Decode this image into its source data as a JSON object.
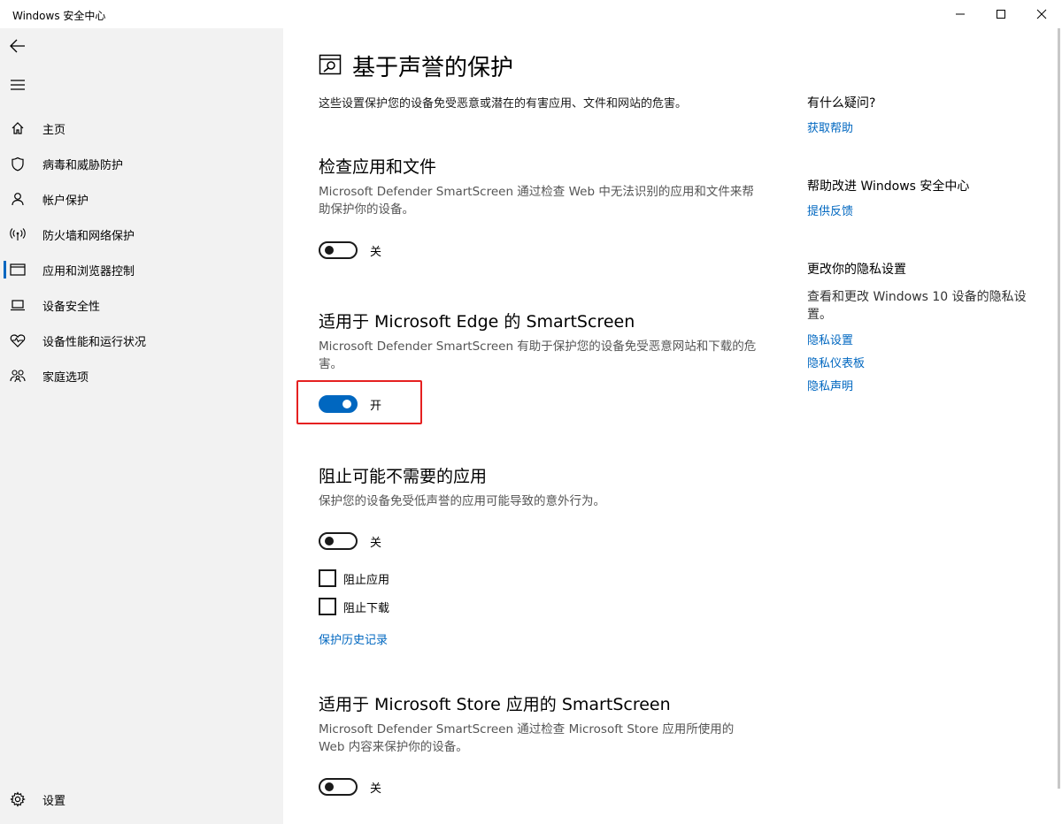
{
  "window": {
    "title": "Windows 安全中心",
    "controls": [
      "minimize-icon",
      "maximize-icon",
      "close-icon"
    ]
  },
  "sidebar": {
    "back_icon": "back-arrow-icon",
    "menu_icon": "hamburger-icon",
    "items": [
      {
        "label": "主页",
        "icon": "home-icon"
      },
      {
        "label": "病毒和威胁防护",
        "icon": "shield-icon"
      },
      {
        "label": "帐户保护",
        "icon": "person-icon"
      },
      {
        "label": "防火墙和网络保护",
        "icon": "antenna-icon"
      },
      {
        "label": "应用和浏览器控制",
        "icon": "app-window-icon",
        "selected": true
      },
      {
        "label": "设备安全性",
        "icon": "laptop-icon"
      },
      {
        "label": "设备性能和运行状况",
        "icon": "heart-pulse-icon"
      },
      {
        "label": "家庭选项",
        "icon": "family-icon"
      }
    ],
    "settings": {
      "label": "设置",
      "icon": "gear-icon"
    }
  },
  "main": {
    "title": "基于声誉的保护",
    "title_icon": "reputation-protection-icon",
    "description": "这些设置保护您的设备免受恶意或潜在的有害应用、文件和网站的危害。",
    "sections": [
      {
        "title": "检查应用和文件",
        "description": "Microsoft Defender SmartScreen 通过检查 Web 中无法识别的应用和文件来帮助保护你的设备。",
        "toggle_state": "off",
        "toggle_label": "关"
      },
      {
        "title": "适用于 Microsoft Edge 的 SmartScreen",
        "description": "Microsoft Defender SmartScreen 有助于保护您的设备免受恶意网站和下载的危害。",
        "toggle_state": "on",
        "toggle_label": "开"
      },
      {
        "title": "阻止可能不需要的应用",
        "description": "保护您的设备免受低声誉的应用可能导致的意外行为。",
        "toggle_state": "off",
        "toggle_label": "关",
        "checkboxes": [
          {
            "label": "阻止应用",
            "checked": false
          },
          {
            "label": "阻止下载",
            "checked": false
          }
        ],
        "link": "保护历史记录"
      },
      {
        "title": "适用于 Microsoft Store 应用的 SmartScreen",
        "description": "Microsoft Defender SmartScreen 通过检查 Microsoft Store 应用所使用的 Web 内容来保护你的设备。",
        "toggle_state": "off",
        "toggle_label": "关"
      }
    ]
  },
  "aside": {
    "question_heading": "有什么疑问?",
    "help_link": "获取帮助",
    "improve_heading": "帮助改进 Windows 安全中心",
    "feedback_link": "提供反馈",
    "privacy_heading": "更改你的隐私设置",
    "privacy_text": "查看和更改 Windows 10 设备的隐私设置。",
    "privacy_links": [
      "隐私设置",
      "隐私仪表板",
      "隐私声明"
    ]
  },
  "colors": {
    "accent": "#0067c0",
    "highlight": "#e52020",
    "sidebar_bg": "#f2f2f2"
  }
}
